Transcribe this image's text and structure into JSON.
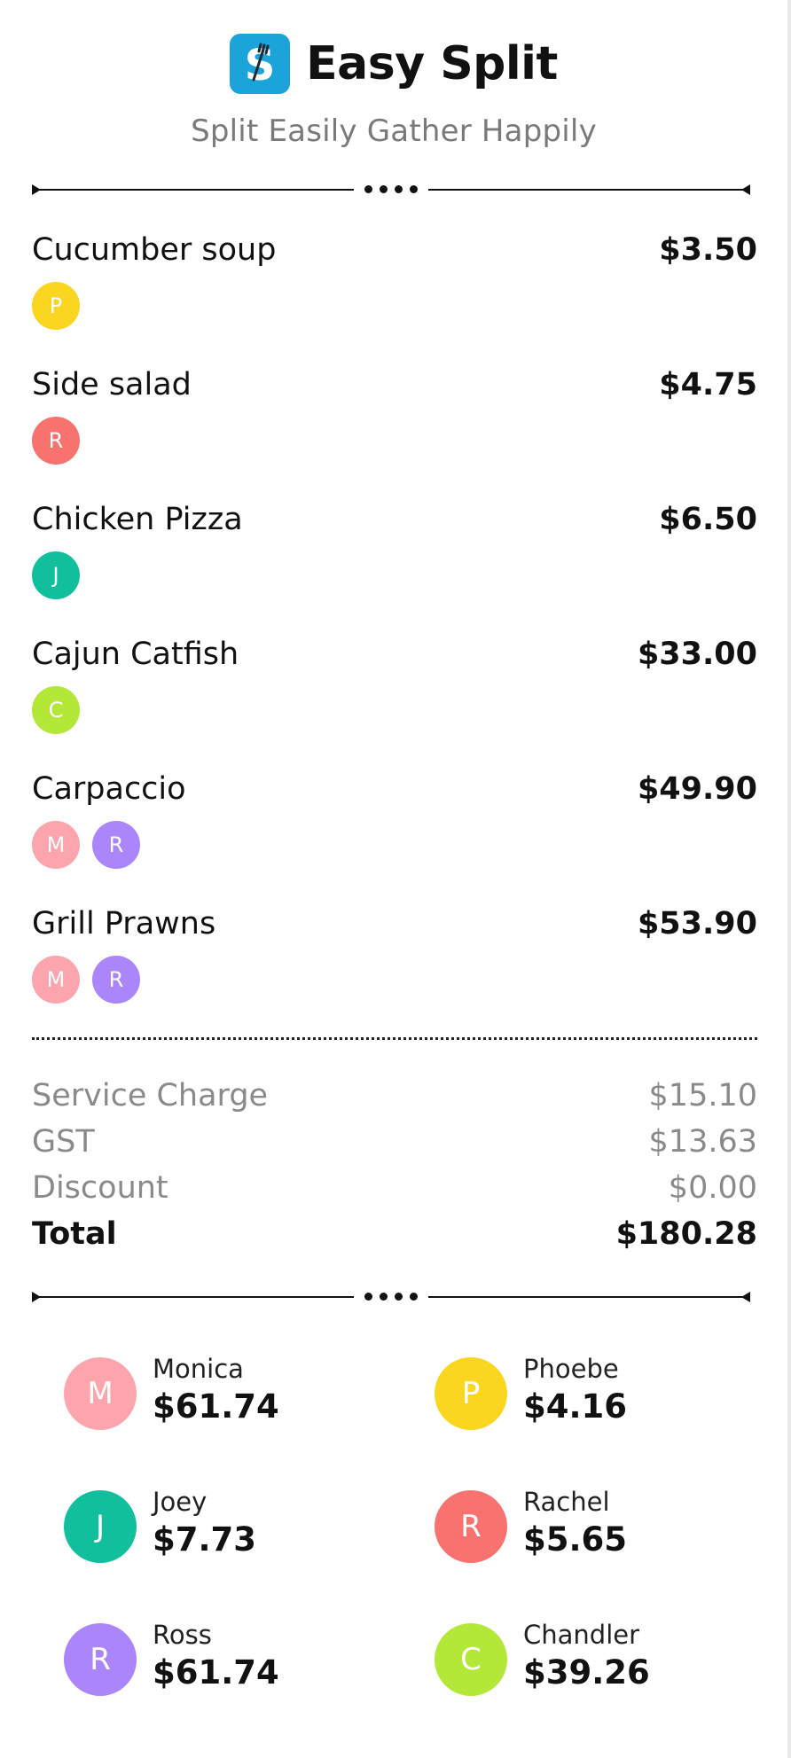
{
  "app": {
    "title": "Easy Split",
    "tagline": "Split Easily Gather Happily",
    "logo_letter": "S",
    "brand_color": "#1aa4d9"
  },
  "items": [
    {
      "name": "Cucumber soup",
      "price": "$3.50",
      "people": [
        {
          "initial": "P",
          "color": "#fbd621"
        }
      ]
    },
    {
      "name": "Side salad",
      "price": "$4.75",
      "people": [
        {
          "initial": "R",
          "color": "#f87370"
        }
      ]
    },
    {
      "name": "Chicken Pizza",
      "price": "$6.50",
      "people": [
        {
          "initial": "J",
          "color": "#11bf9c"
        }
      ]
    },
    {
      "name": "Cajun Catfish",
      "price": "$33.00",
      "people": [
        {
          "initial": "C",
          "color": "#b4e838"
        }
      ]
    },
    {
      "name": "Carpaccio",
      "price": "$49.90",
      "people": [
        {
          "initial": "M",
          "color": "#fca5ac"
        },
        {
          "initial": "R",
          "color": "#aa86fa"
        }
      ]
    },
    {
      "name": "Grill Prawns",
      "price": "$53.90",
      "people": [
        {
          "initial": "M",
          "color": "#fca5ac"
        },
        {
          "initial": "R",
          "color": "#aa86fa"
        }
      ]
    }
  ],
  "summary": {
    "service_charge": {
      "label": "Service Charge",
      "value": "$15.10"
    },
    "gst": {
      "label": "GST",
      "value": "$13.63"
    },
    "discount": {
      "label": "Discount",
      "value": "$0.00"
    },
    "total": {
      "label": "Total",
      "value": "$180.28"
    }
  },
  "people": [
    {
      "initial": "M",
      "name": "Monica",
      "amount": "$61.74",
      "color": "#fca5ac"
    },
    {
      "initial": "P",
      "name": "Phoebe",
      "amount": "$4.16",
      "color": "#fbd621"
    },
    {
      "initial": "J",
      "name": "Joey",
      "amount": "$7.73",
      "color": "#11bf9c"
    },
    {
      "initial": "R",
      "name": "Rachel",
      "amount": "$5.65",
      "color": "#f87370"
    },
    {
      "initial": "R",
      "name": "Ross",
      "amount": "$61.74",
      "color": "#aa86fa"
    },
    {
      "initial": "C",
      "name": "Chandler",
      "amount": "$39.26",
      "color": "#b4e838"
    }
  ]
}
